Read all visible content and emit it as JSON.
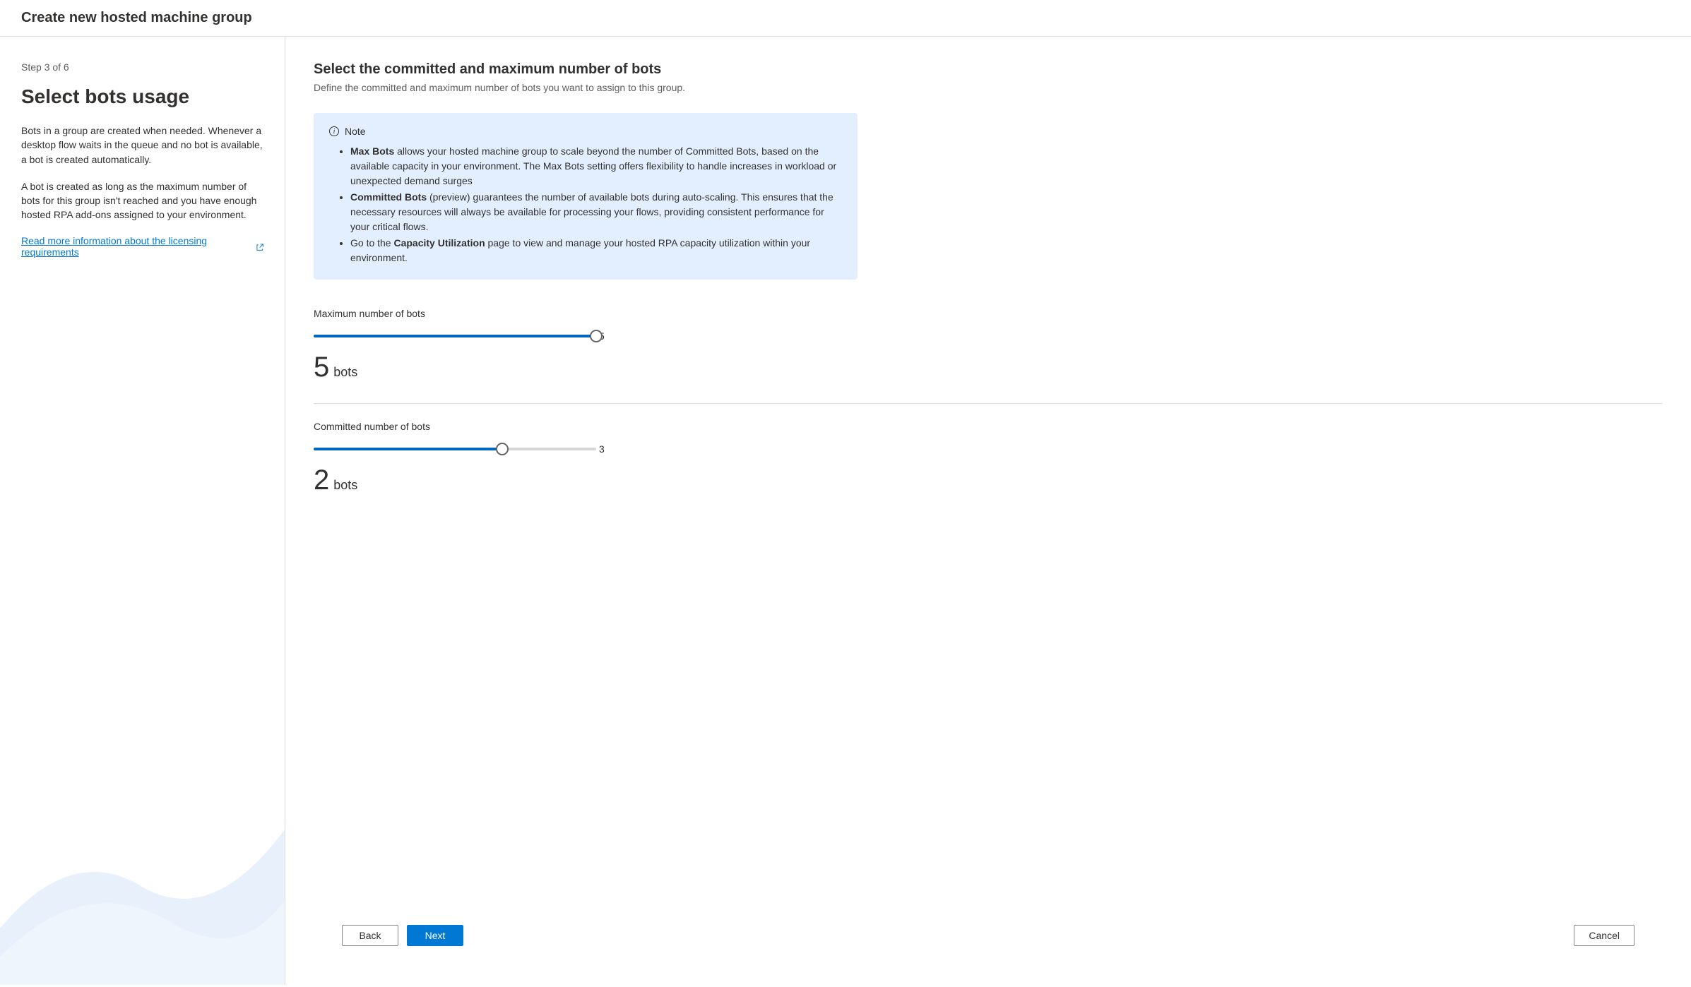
{
  "header": {
    "title": "Create new hosted machine group"
  },
  "sidebar": {
    "step_indicator": "Step 3 of 6",
    "title": "Select bots usage",
    "paragraph1": "Bots in a group are created when needed. Whenever a desktop flow waits in the queue and no bot is available, a bot is created automatically.",
    "paragraph2": "A bot is created as long as the maximum number of bots for this group isn't reached and you have enough hosted RPA add-ons assigned to your environment.",
    "link_text": "Read more information about the licensing requirements"
  },
  "main": {
    "title": "Select the committed and maximum number of bots",
    "subtitle": "Define the committed and maximum number of bots you want to assign to this group.",
    "note": {
      "label": "Note",
      "item1_bold": "Max Bots",
      "item1_text": " allows your hosted machine group to scale beyond the number of Committed Bots, based on the available capacity in your environment. The Max Bots setting offers flexibility to handle increases in workload or unexpected demand surges",
      "item2_bold": "Committed Bots",
      "item2_text": " (preview) guarantees the number of available bots during auto-scaling. This ensures that the necessary resources will always be available for processing your flows, providing consistent performance for your critical flows.",
      "item3_prefix": "Go to the ",
      "item3_bold": "Capacity Utilization",
      "item3_text": " page to view and manage your hosted RPA capacity utilization within your environment."
    },
    "slider_max": {
      "label": "Maximum number of bots",
      "value": "5",
      "max_label": "5",
      "fill_percent": 100,
      "display_number": "5",
      "display_unit": "bots"
    },
    "slider_committed": {
      "label": "Committed number of bots",
      "value": "2",
      "max_label": "3",
      "fill_percent": 66.7,
      "display_number": "2",
      "display_unit": "bots"
    }
  },
  "footer": {
    "back": "Back",
    "next": "Next",
    "cancel": "Cancel"
  }
}
